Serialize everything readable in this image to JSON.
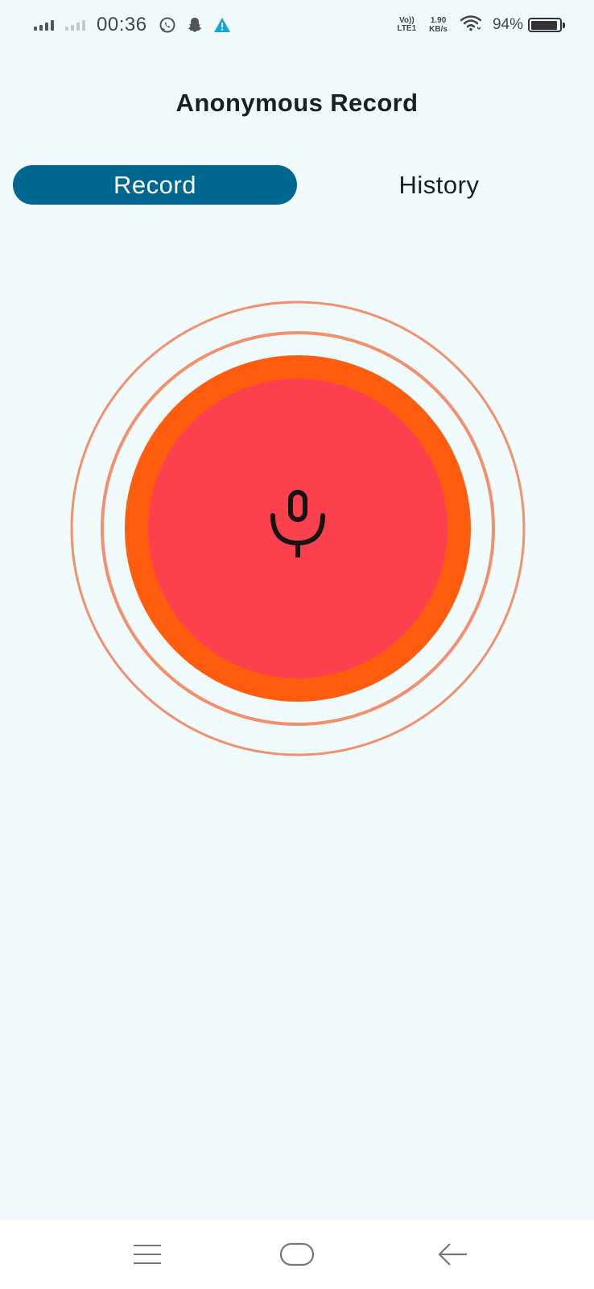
{
  "status_bar": {
    "time": "00:36",
    "volte_top": "Vo))",
    "volte_bottom": "LTE1",
    "speed_value": "1.90",
    "speed_unit": "KB/s",
    "battery_percent": "94%",
    "battery_level": 0.94,
    "icons": [
      "signal-icon",
      "signal-secondary-icon",
      "whatsapp-icon",
      "snapchat-icon",
      "warning-icon",
      "wifi-icon",
      "battery-icon"
    ]
  },
  "app": {
    "title": "Anonymous Record"
  },
  "tabs": [
    {
      "label": "Record",
      "active": true
    },
    {
      "label": "History",
      "active": false
    }
  ],
  "record_button": {
    "icon": "microphone-icon",
    "colors": {
      "inner": "#fd404e",
      "ring": "#ff5c0e",
      "pulse": "#f28f6d"
    }
  },
  "nav_bar": {
    "icons": [
      "menu-icon",
      "home-icon",
      "back-icon"
    ]
  },
  "colors": {
    "background": "#f1fbfd",
    "accent": "#006890"
  }
}
